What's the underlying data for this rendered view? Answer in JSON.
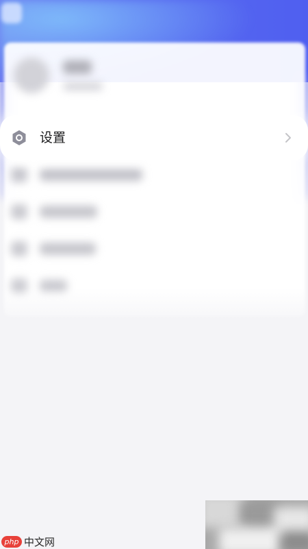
{
  "settings_row": {
    "label": "设置",
    "icon": "gear-icon",
    "chevron": "chevron-right-icon"
  },
  "watermark": {
    "logo_text": "php",
    "site_text": "中文网"
  },
  "colors": {
    "header_blue": "#5a6cf0",
    "icon_gray": "#8e8e9a",
    "chevron_gray": "#c4c4c8",
    "watermark_red": "#e8413a"
  }
}
